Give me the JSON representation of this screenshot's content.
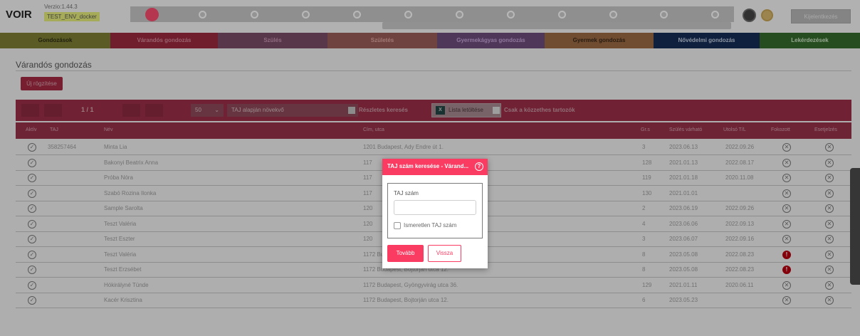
{
  "header": {
    "logo": "VOIR",
    "version": "Verzio:1.44.3",
    "env": "TEST_ENV_docker",
    "logout_label": "Kijelentkezés"
  },
  "nav": [
    {
      "label": "Gondozások",
      "bg": "#7f7f34",
      "color": "#2e2e12"
    },
    {
      "label": "Várandós gondozás",
      "bg": "#9c2a40",
      "color": "#d48898"
    },
    {
      "label": "Szülés",
      "bg": "#7b4d67",
      "color": "#c994b1"
    },
    {
      "label": "Születés",
      "bg": "#9a5d58",
      "color": "#e0a8a2"
    },
    {
      "label": "Gyermekágyas gondozás",
      "bg": "#6d4d7b",
      "color": "#c6a4d9"
    },
    {
      "label": "Gyermek gondozás",
      "bg": "#9b6a45",
      "color": "#3a2817"
    },
    {
      "label": "Nővédelmi gondozás",
      "bg": "#162d57",
      "color": "#c2cde0"
    },
    {
      "label": "Lekérdezések",
      "bg": "#356b2c",
      "color": "#cfe6c8"
    }
  ],
  "page": {
    "title": "Várandós gondozás",
    "new_button": "Új rögzítése"
  },
  "toolbar": {
    "pager": "1 / 1",
    "per_page": "50",
    "sort": "TAJ alapján növekvő",
    "detailed_search": "Részletes keresés",
    "xls_icon": "X",
    "download_list": "Lista letöltése",
    "only_open": "Csak a közzethes tartozók"
  },
  "table": {
    "headers": [
      "Aktív",
      "TAJ",
      "Név",
      "Cím, utca",
      "Gr.s",
      "Szülés várható",
      "Utolsó T/L",
      "Fokozott",
      "Esetjelzés"
    ],
    "rows": [
      {
        "taj": "358257464",
        "name": "Minta Lia",
        "address": "1201 Budapest, Ady Endre út 1.",
        "grs": "3",
        "due": "2023.06.13",
        "last": "2022.09.26",
        "fok": "normal"
      },
      {
        "taj": "",
        "name": "Bakonyi Beatrix Anna",
        "address": "117",
        "grs": "128",
        "due": "2021.01.13",
        "last": "2022.08.17",
        "fok": "normal"
      },
      {
        "taj": "",
        "name": "Próba Nóra",
        "address": "117",
        "grs": "119",
        "due": "2021.01.18",
        "last": "2020.11.08",
        "fok": "normal"
      },
      {
        "taj": "",
        "name": "Szabó Rozina Ilonka",
        "address": "117",
        "grs": "130",
        "due": "2021.01.01",
        "last": "",
        "fok": "normal"
      },
      {
        "taj": "",
        "name": "Sample Sarolta",
        "address": "120",
        "grs": "2",
        "due": "2023.06.19",
        "last": "2022.09.26",
        "fok": "normal"
      },
      {
        "taj": "",
        "name": "Teszt Valéria",
        "address": "120",
        "grs": "4",
        "due": "2023.06.06",
        "last": "2022.09.13",
        "fok": "normal"
      },
      {
        "taj": "",
        "name": "Teszt Eszter",
        "address": "120",
        "grs": "3",
        "due": "2023.06.07",
        "last": "2022.09.16",
        "fok": "normal"
      },
      {
        "taj": "",
        "name": "Teszt Valéria",
        "address": "1172 Budapest, Bojtorján utca 12.",
        "grs": "8",
        "due": "2023.05.08",
        "last": "2022.08.23",
        "fok": "alert"
      },
      {
        "taj": "",
        "name": "Teszt Erzsébet",
        "address": "1172 Budapest, Bojtorján utca 12.",
        "grs": "8",
        "due": "2023.05.08",
        "last": "2022.08.23",
        "fok": "alert"
      },
      {
        "taj": "",
        "name": "Hókirályné Tünde",
        "address": "1172 Budapest, Gyöngyvirág utca 36.",
        "grs": "129",
        "due": "2021.01.11",
        "last": "2020.06.11",
        "fok": "normal"
      },
      {
        "taj": "",
        "name": "Kacér Krisztina",
        "address": "1172 Budapest, Bojtorján utca 12.",
        "grs": "6",
        "due": "2023.05.23",
        "last": "",
        "fok": "normal"
      }
    ]
  },
  "icons": {
    "active": "✓",
    "cross": "✕",
    "alert": "!",
    "help": "?"
  },
  "modal": {
    "title": "TAJ szám keresése - Várand...",
    "field_label": "TAJ szám",
    "field_value": "",
    "unknown_label": "Ismeretlen TAJ szám",
    "next": "Tovább",
    "back": "Vissza"
  },
  "colors": {
    "accent": "#fb3c62",
    "stepper_active": "#fb4c6e"
  }
}
